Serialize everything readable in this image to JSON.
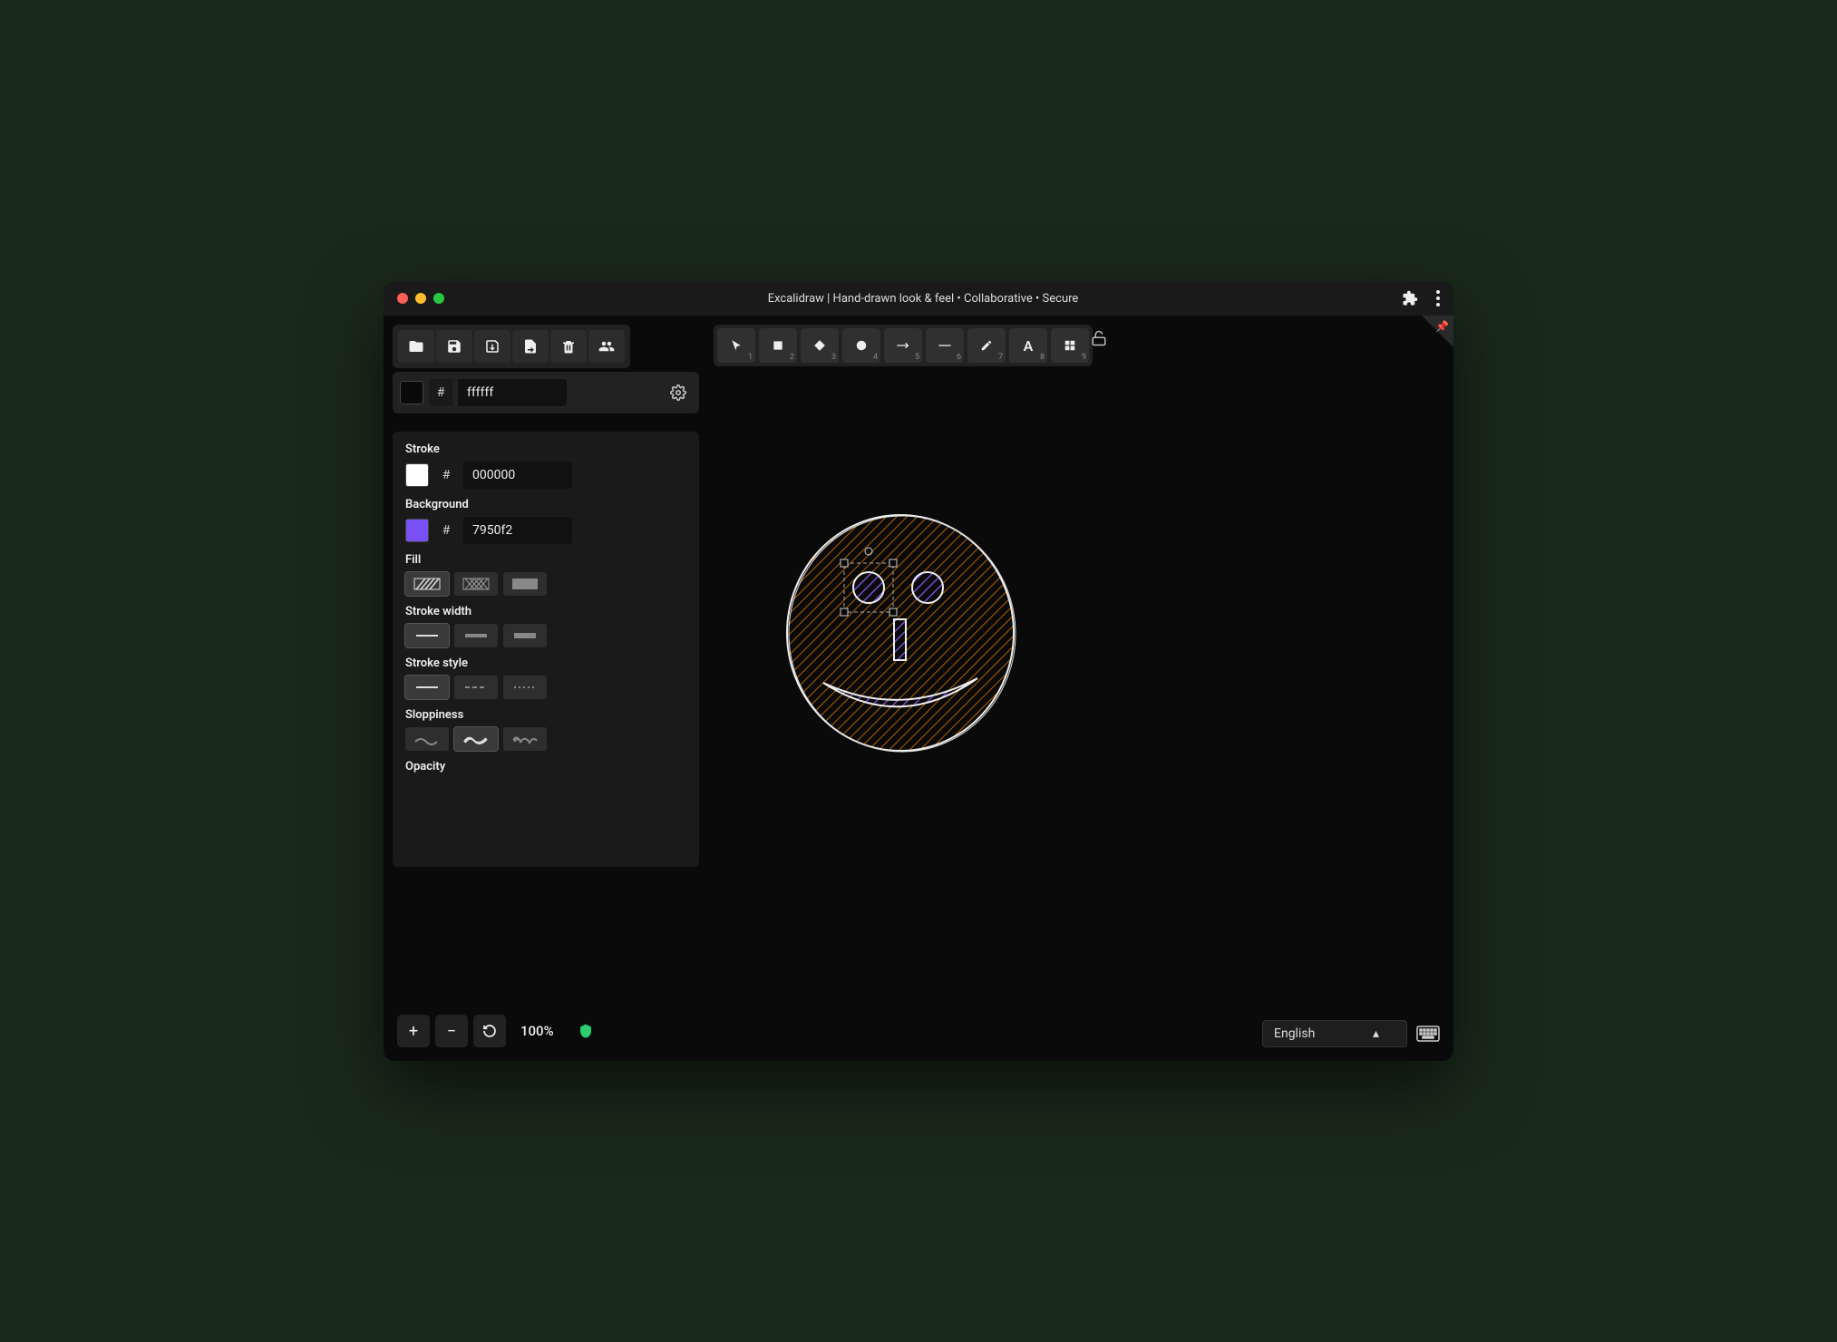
{
  "titlebar": {
    "title": "Excalidraw | Hand-drawn look & feel • Collaborative • Secure"
  },
  "file_toolbar": {
    "open": "Open",
    "save": "Save",
    "saveas": "Save as",
    "export": "Export",
    "delete": "Delete",
    "collab": "Collaborate"
  },
  "canvas_bg": {
    "hash": "#",
    "value": "ffffff",
    "swatch_color": "#0a0a0a"
  },
  "tools": [
    {
      "name": "select",
      "num": "1"
    },
    {
      "name": "rectangle",
      "num": "2"
    },
    {
      "name": "diamond",
      "num": "3"
    },
    {
      "name": "ellipse",
      "num": "4"
    },
    {
      "name": "arrow",
      "num": "5"
    },
    {
      "name": "line",
      "num": "6"
    },
    {
      "name": "draw",
      "num": "7"
    },
    {
      "name": "text",
      "num": "8"
    },
    {
      "name": "library",
      "num": "9"
    }
  ],
  "props": {
    "stroke_label": "Stroke",
    "stroke_hash": "#",
    "stroke_value": "000000",
    "stroke_swatch": "#ffffff",
    "bg_label": "Background",
    "bg_hash": "#",
    "bg_value": "7950f2",
    "bg_swatch": "#7950f2",
    "fill_label": "Fill",
    "stroke_width_label": "Stroke width",
    "stroke_style_label": "Stroke style",
    "sloppiness_label": "Sloppiness",
    "opacity_label": "Opacity"
  },
  "footer": {
    "zoom_pct": "100%",
    "language": "English"
  }
}
